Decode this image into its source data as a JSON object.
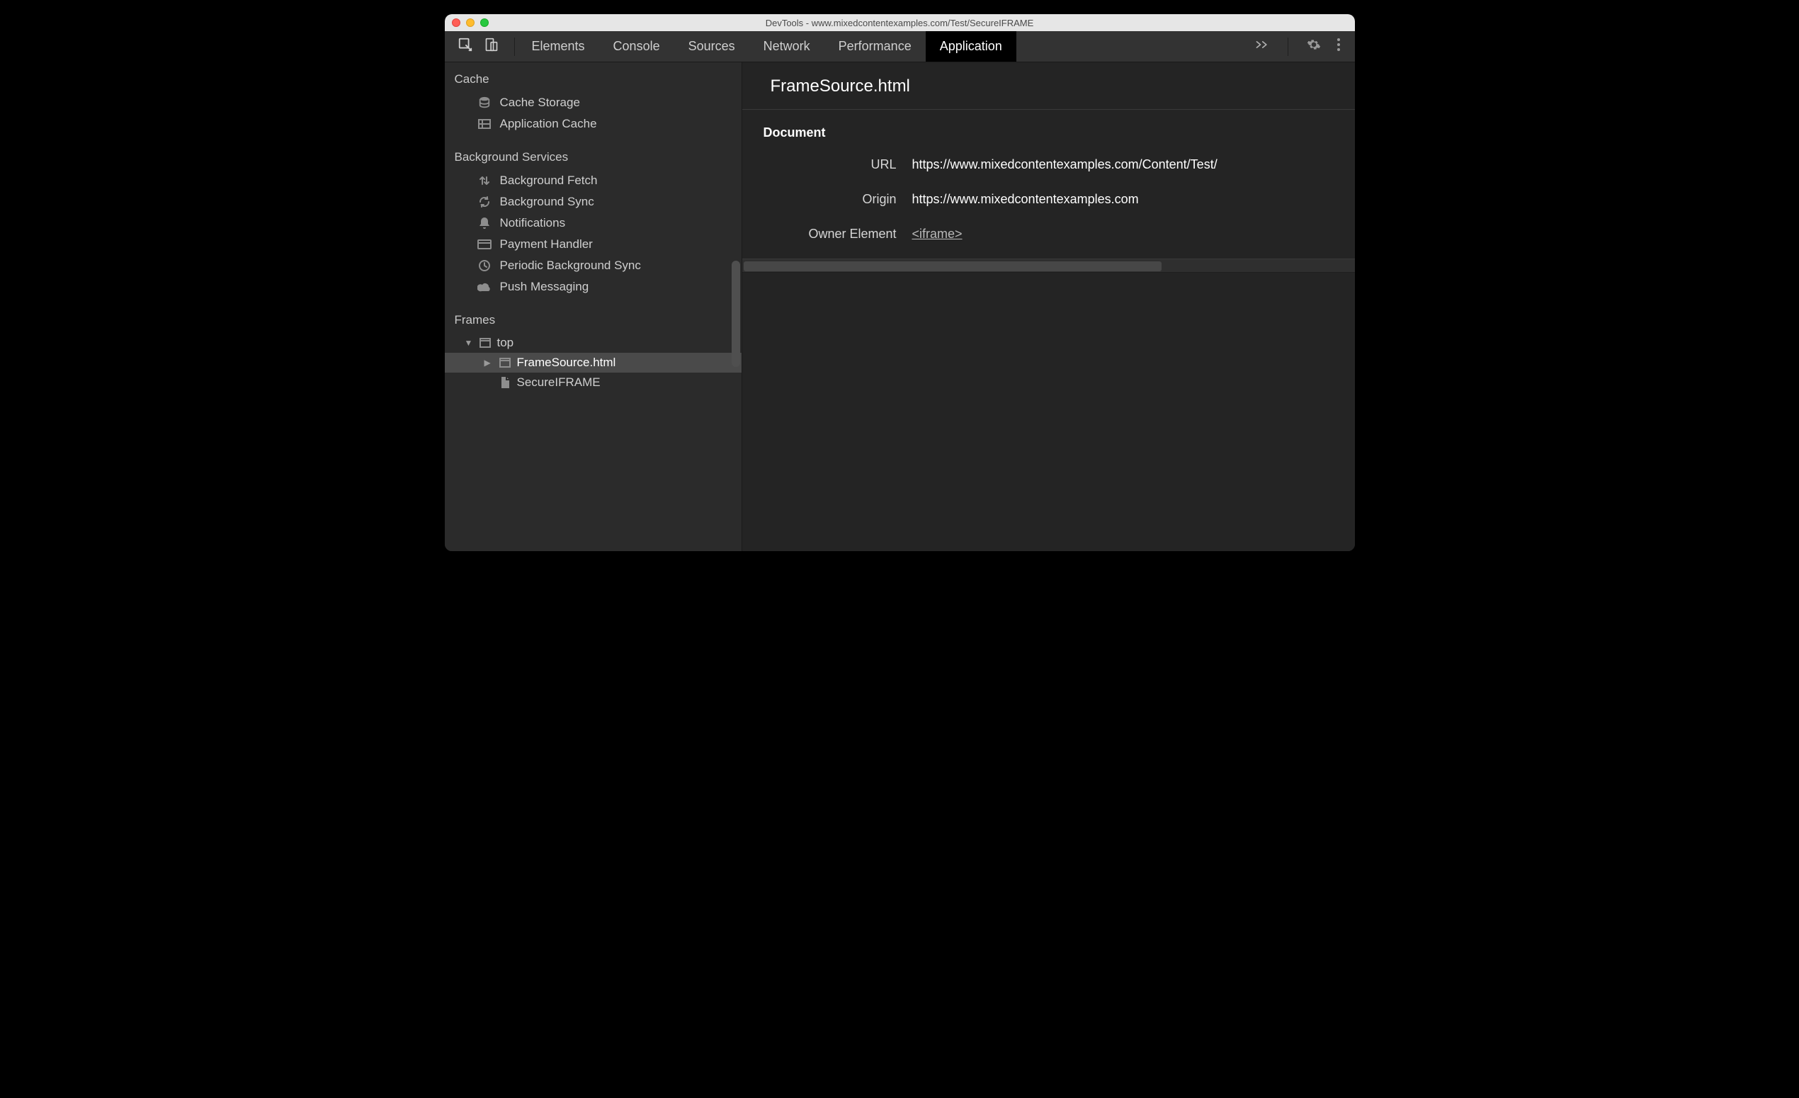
{
  "window": {
    "title": "DevTools - www.mixedcontentexamples.com/Test/SecureIFRAME"
  },
  "toolbar": {
    "tabs": {
      "elements": "Elements",
      "console": "Console",
      "sources": "Sources",
      "network": "Network",
      "performance": "Performance",
      "application": "Application"
    }
  },
  "sidebar": {
    "sections": {
      "cache": {
        "label": "Cache",
        "items": {
          "cache_storage": "Cache Storage",
          "application_cache": "Application Cache"
        }
      },
      "background_services": {
        "label": "Background Services",
        "items": {
          "background_fetch": "Background Fetch",
          "background_sync": "Background Sync",
          "notifications": "Notifications",
          "payment_handler": "Payment Handler",
          "periodic_background_sync": "Periodic Background Sync",
          "push_messaging": "Push Messaging"
        }
      },
      "frames": {
        "label": "Frames",
        "tree": {
          "top": "top",
          "frame_source": "FrameSource.html",
          "secure_iframe": "SecureIFRAME"
        }
      }
    }
  },
  "main": {
    "title": "FrameSource.html",
    "document": {
      "label": "Document",
      "rows": {
        "url": {
          "label": "URL",
          "value": "https://www.mixedcontentexamples.com/Content/Test/"
        },
        "origin": {
          "label": "Origin",
          "value": "https://www.mixedcontentexamples.com"
        },
        "owner_element": {
          "label": "Owner Element",
          "value": "<iframe>"
        }
      }
    }
  }
}
